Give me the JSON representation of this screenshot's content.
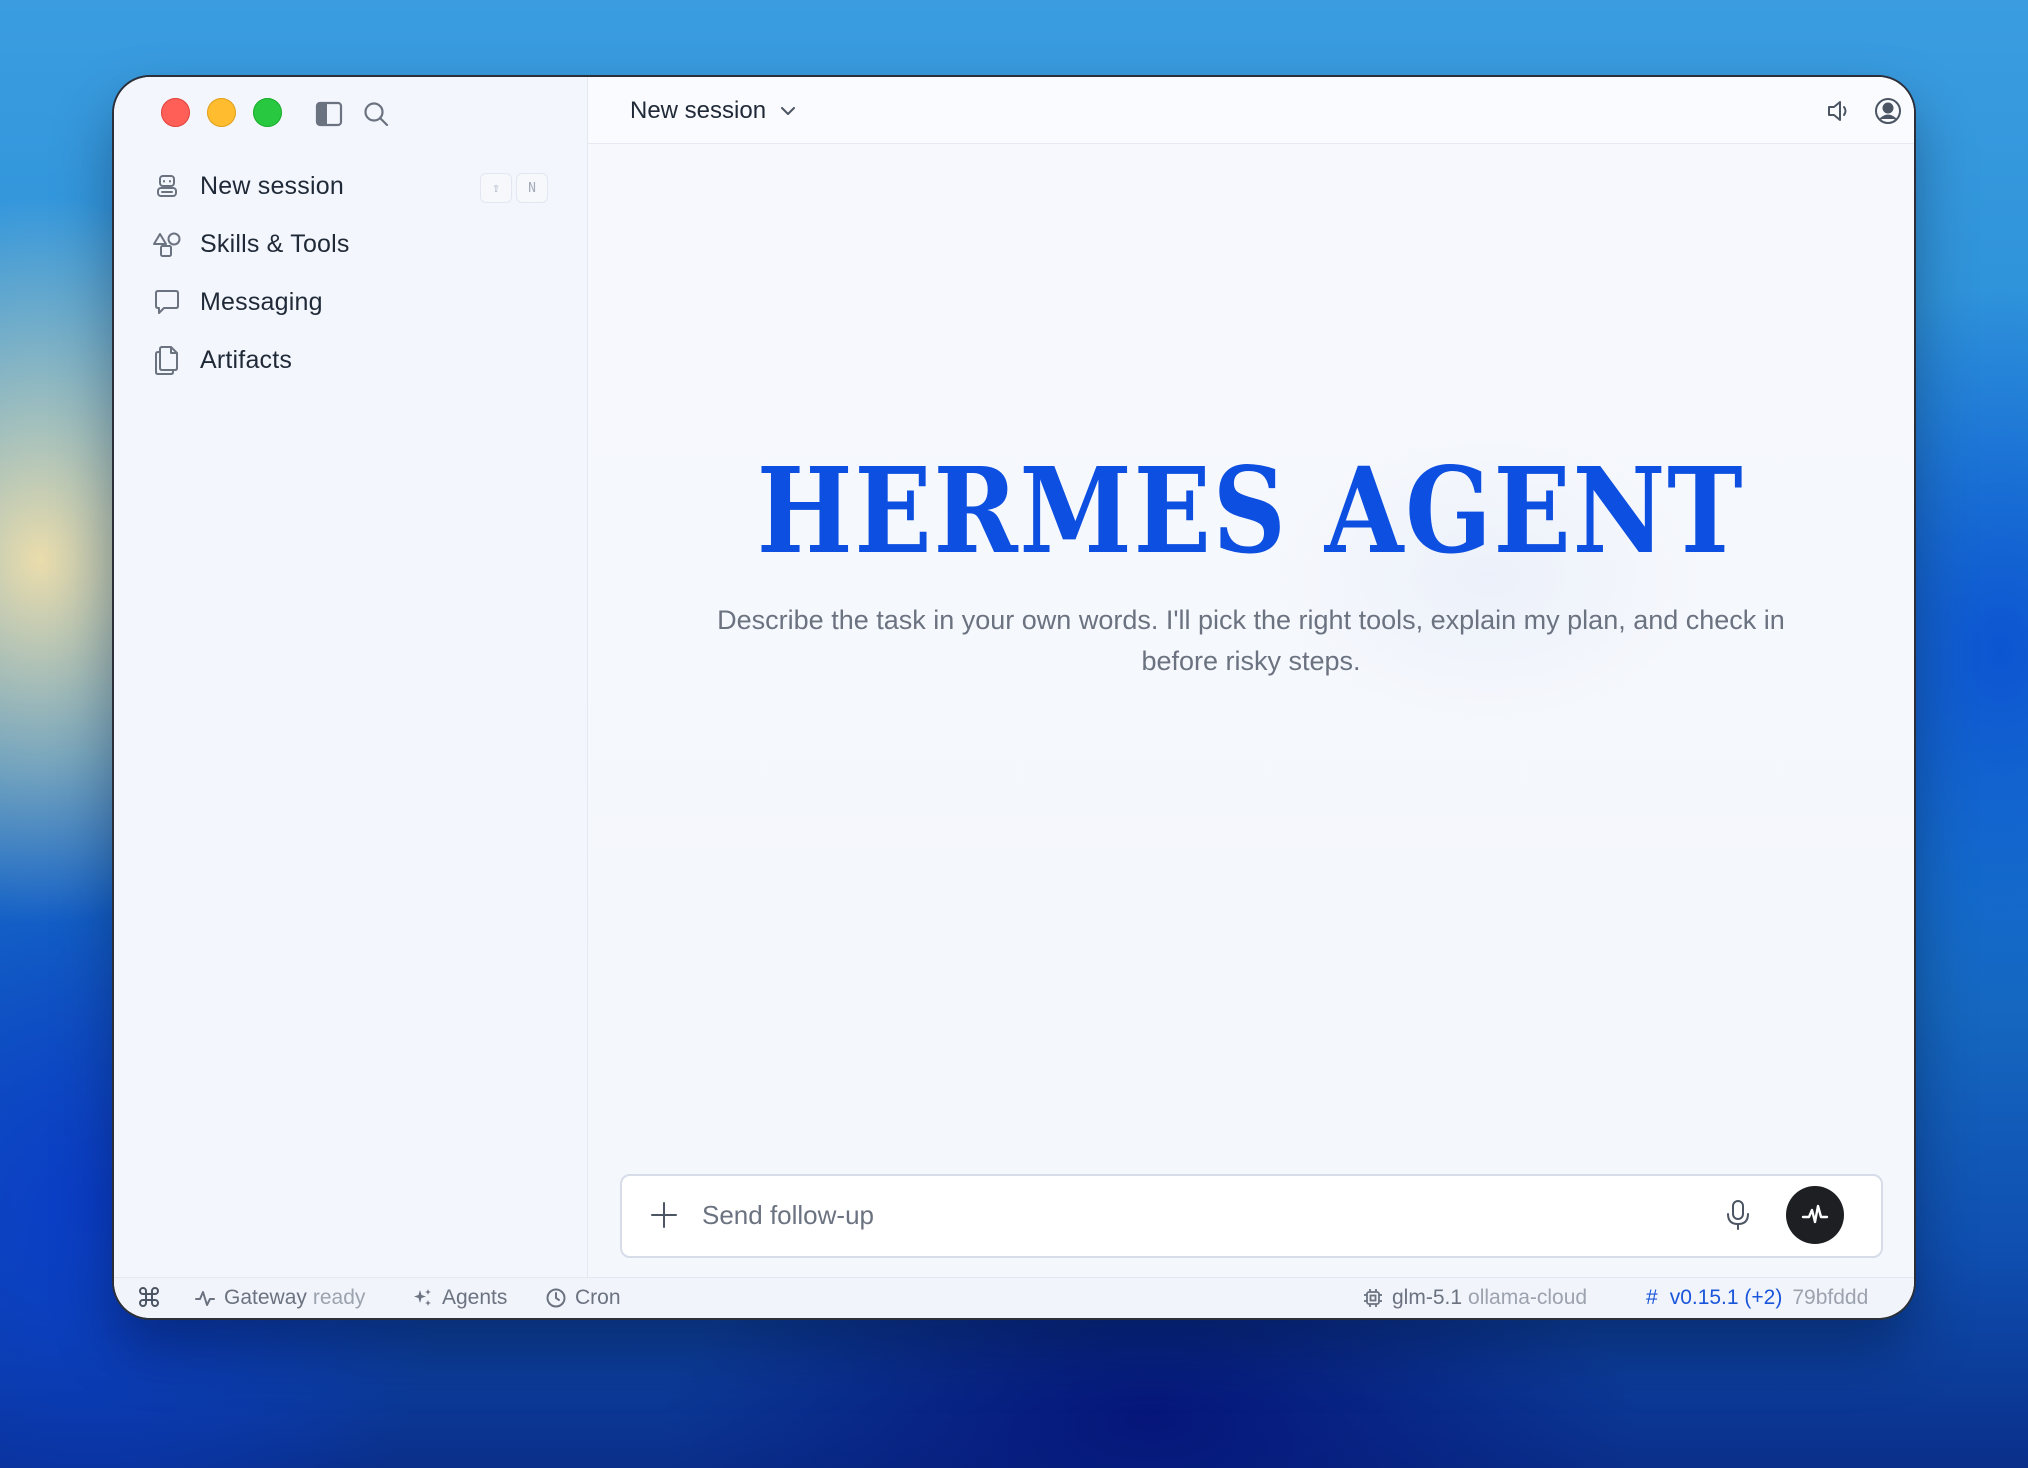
{
  "sidebar": {
    "items": [
      {
        "label": "New session",
        "icon": "robot-icon",
        "shortcut": [
          "⇧",
          "N"
        ]
      },
      {
        "label": "Skills & Tools",
        "icon": "shapes-icon"
      },
      {
        "label": "Messaging",
        "icon": "chat-bubble-icon"
      },
      {
        "label": "Artifacts",
        "icon": "documents-icon"
      }
    ]
  },
  "header": {
    "session_title": "New session"
  },
  "main": {
    "hero_title": "HERMES AGENT",
    "hero_subtitle": "Describe the task in your own words. I'll pick the right tools, explain my plan, and check in before risky steps."
  },
  "composer": {
    "placeholder": "Send follow-up"
  },
  "statusbar": {
    "gateway_label": "Gateway",
    "gateway_status": "ready",
    "agents_label": "Agents",
    "cron_label": "Cron",
    "model_name": "glm-5.1",
    "model_provider": "ollama-cloud",
    "version_hash_symbol": "#",
    "version": "v0.15.1 (+2)",
    "commit": "79bfddd"
  },
  "colors": {
    "accent": "#0d4fe0",
    "link_blue": "#1a56db",
    "send_button": "#1e1f23"
  }
}
